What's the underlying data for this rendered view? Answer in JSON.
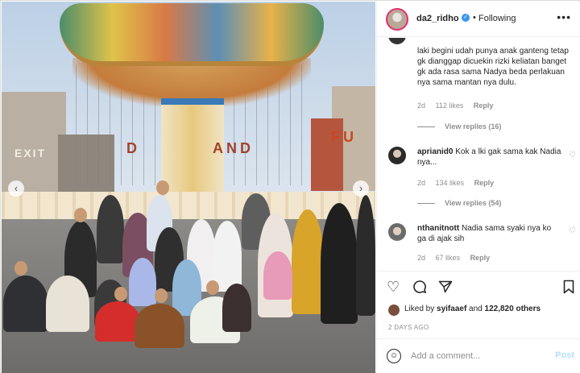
{
  "post": {
    "photo_signs": {
      "exit": "EXIT",
      "fun": "FU",
      "land": "AND",
      "d": "D"
    }
  },
  "header": {
    "username": "da2_ridho",
    "separator": "•",
    "follow_status": "Following",
    "more_icon": "more-horizontal-icon"
  },
  "comments": [
    {
      "text": "laki begini udah punya anak ganteng tetap gk dianggap dicuekin rizki keliatan banget gk ada rasa sama Nadya beda perlakuan nya sama mantan nya dulu.",
      "age": "2d",
      "likes": "112 likes",
      "reply": "Reply",
      "view_replies": "View replies (16)"
    },
    {
      "username": "aprianid0",
      "text": "Kok a lki gak sama kak Nadia nya...",
      "age": "2d",
      "likes": "134 likes",
      "reply": "Reply",
      "view_replies": "View replies (54)"
    },
    {
      "username": "nthanitnott",
      "text": "Nadia sama syaki nya ko ga di ajak sih",
      "age": "2d",
      "likes": "67 likes",
      "reply": "Reply"
    }
  ],
  "actions": {
    "like_icon": "heart-icon",
    "comment_icon": "comment-icon",
    "share_icon": "send-icon",
    "save_icon": "bookmark-icon"
  },
  "likes": {
    "prefix": "Liked by ",
    "user": "syifaaef",
    "and": " and ",
    "others": "122,820 others"
  },
  "timestamp": "2 DAYS AGO",
  "add_comment": {
    "placeholder": "Add a comment...",
    "post_label": "Post",
    "emoji_icon": "smiley-icon"
  },
  "colors": {
    "accent_blue": "#3897f0",
    "post_disabled": "#b2dffc",
    "story_ring": "#e1306c"
  }
}
